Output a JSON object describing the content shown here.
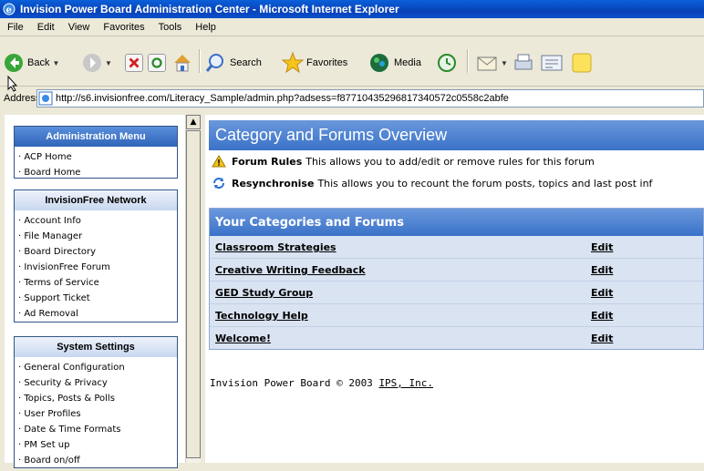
{
  "window": {
    "title": "Invision Power Board Administration Center - Microsoft Internet Explorer"
  },
  "menubar": [
    "File",
    "Edit",
    "View",
    "Favorites",
    "Tools",
    "Help"
  ],
  "toolbar": {
    "back_label": "Back",
    "search_label": "Search",
    "favorites_label": "Favorites",
    "media_label": "Media"
  },
  "address": {
    "label": "Address",
    "url": "http://s6.invisionfree.com/Literacy_Sample/admin.php?adsess=f87710435296817340572c0558c2abfe"
  },
  "sidebar": {
    "admin_menu": {
      "title": "Administration Menu",
      "items": [
        "ACP Home",
        "Board Home"
      ]
    },
    "network": {
      "title": "InvisionFree Network",
      "items": [
        "Account Info",
        "File Manager",
        "Board Directory",
        "InvisionFree Forum",
        "Terms of Service",
        "Support Ticket",
        "Ad Removal"
      ]
    },
    "system": {
      "title": "System Settings",
      "items": [
        "General Configuration",
        "Security & Privacy",
        "Topics, Posts & Polls",
        "User Profiles",
        "Date & Time Formats",
        "PM Set up",
        "Board on/off"
      ]
    }
  },
  "main": {
    "title": "Category and Forums Overview",
    "rules": {
      "label": "Forum Rules",
      "text": "This allows you to add/edit or remove rules for this forum"
    },
    "resync": {
      "label": "Resynchronise",
      "text": "This allows you to recount the forum posts, topics and last post inf"
    },
    "categories_title": "Your Categories and Forums",
    "forums": [
      {
        "name": "Classroom Strategies",
        "edit": "Edit"
      },
      {
        "name": "Creative Writing Feedback",
        "edit": "Edit"
      },
      {
        "name": "GED Study Group",
        "edit": "Edit"
      },
      {
        "name": "Technology Help",
        "edit": "Edit"
      },
      {
        "name": "Welcome!",
        "edit": "Edit"
      }
    ],
    "footer_text": "Invision Power Board © 2003",
    "footer_link": "IPS, Inc."
  },
  "colors": {
    "title_bar": "#0842b8",
    "header_blue": "#3a72c8",
    "table_bg": "#d9e3f1"
  }
}
